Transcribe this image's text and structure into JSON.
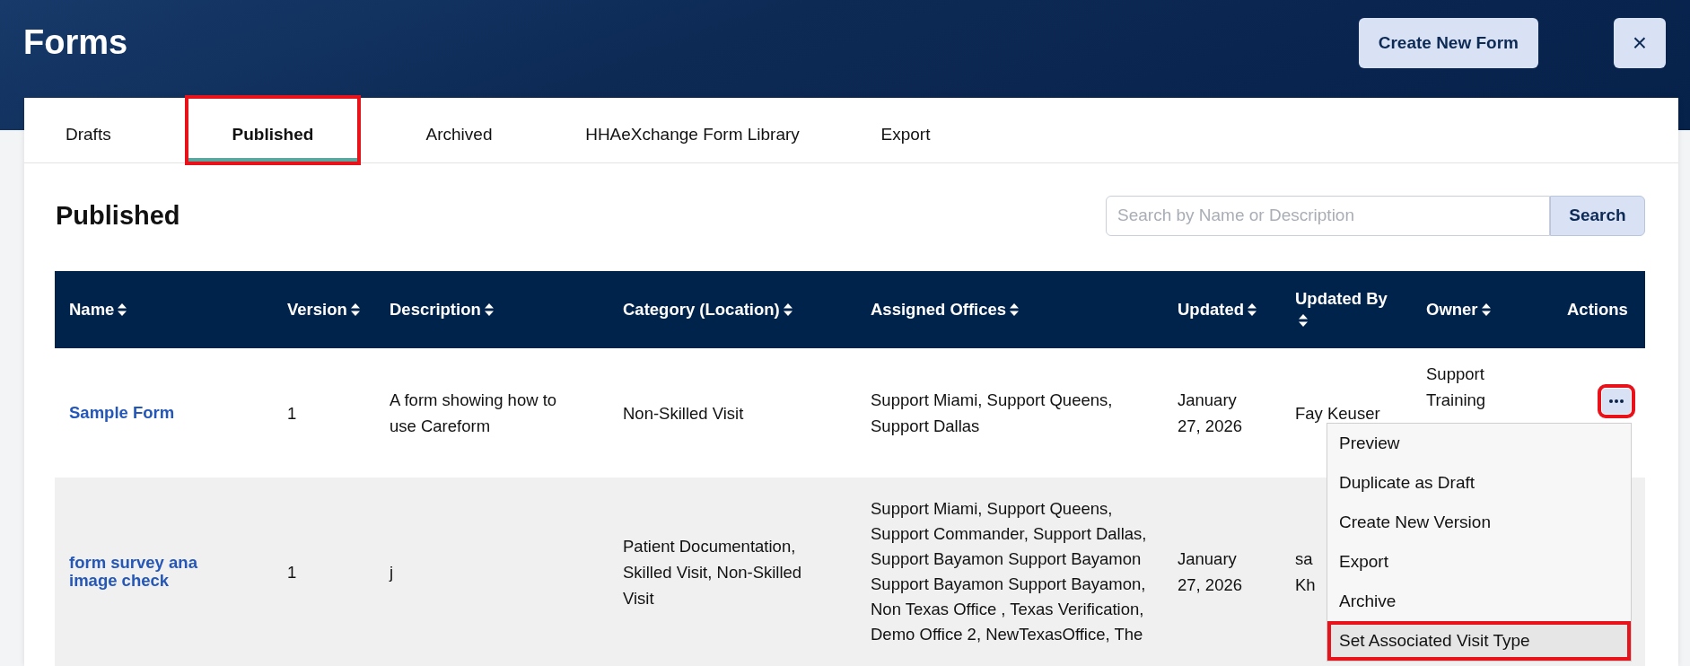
{
  "header": {
    "title": "Forms",
    "create_button": "Create New Form",
    "close_button": "×"
  },
  "tabs": [
    {
      "label": "Drafts",
      "selected": false,
      "highlighted": false
    },
    {
      "label": "Published",
      "selected": true,
      "highlighted": true
    },
    {
      "label": "Archived",
      "selected": false,
      "highlighted": false
    },
    {
      "label": "HHAeXchange Form Library",
      "selected": false,
      "highlighted": false
    },
    {
      "label": "Export",
      "selected": false,
      "highlighted": false
    }
  ],
  "section_title": "Published",
  "search": {
    "placeholder": "Search by Name or Description",
    "button": "Search"
  },
  "table": {
    "columns": [
      {
        "label": "Name",
        "sortable": true
      },
      {
        "label": "Version",
        "sortable": true
      },
      {
        "label": "Description",
        "sortable": true
      },
      {
        "label": "Category (Location)",
        "sortable": true
      },
      {
        "label": "Assigned Offices",
        "sortable": true
      },
      {
        "label": "Updated",
        "sortable": true
      },
      {
        "label": "Updated By",
        "sortable": true
      },
      {
        "label": "Owner",
        "sortable": true
      },
      {
        "label": "Actions",
        "sortable": false
      }
    ],
    "rows": [
      {
        "name": "Sample Form",
        "version": "1",
        "description": "A form showing how to use Careform",
        "category": "Non-Skilled Visit",
        "offices": "Support Miami, Support Queens, Support Dallas",
        "updated": "January 27, 2026",
        "updated_by": "Fay Keuser",
        "owner": "Support Training",
        "actions_highlighted": true,
        "menu_open": true
      },
      {
        "name": "form survey ana image check",
        "version": "1",
        "description": "j",
        "category": "Patient Documentation, Skilled Visit, Non-Skilled Visit",
        "offices": "Support Miami, Support Queens, Support Commander, Support Dallas, Support Bayamon Support Bayamon Support Bayamon Support Bayamon, Non Texas Office , Texas Verification, Demo Office 2, NewTexasOffice, The",
        "updated": "January 27, 2026",
        "updated_by": "sa Kh",
        "menu_open": false
      }
    ]
  },
  "actions_menu": [
    {
      "label": "Preview",
      "hovered": false,
      "highlighted": false
    },
    {
      "label": "Duplicate as Draft",
      "hovered": false,
      "highlighted": false
    },
    {
      "label": "Create New Version",
      "hovered": false,
      "highlighted": false
    },
    {
      "label": "Export",
      "hovered": false,
      "highlighted": false
    },
    {
      "label": "Archive",
      "hovered": false,
      "highlighted": false
    },
    {
      "label": "Set Associated Visit Type",
      "hovered": true,
      "highlighted": true
    }
  ]
}
